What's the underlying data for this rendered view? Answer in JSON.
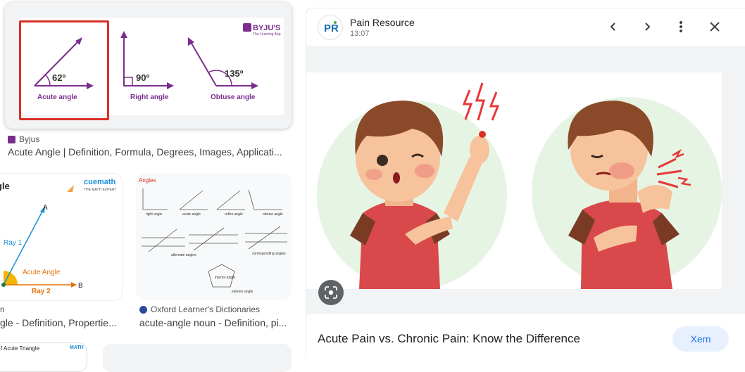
{
  "results": [
    {
      "source": "Byjus",
      "title": "Acute Angle | Definition, Formula, Degrees, Images, Applicati...",
      "image": {
        "brand": "BYJU'S",
        "brand_sub": "The Learning App",
        "angles": [
          {
            "value": "62º",
            "label": "Acute angle"
          },
          {
            "value": "90º",
            "label": "Right angle"
          },
          {
            "value": "135º",
            "label": "Obtuse angle"
          }
        ]
      }
    },
    {
      "source": "n",
      "title": "gle - Definition, Propertie...",
      "image": {
        "heading": "gle",
        "brand": "cuemath",
        "brand_sub": "THE MATH EXPERT",
        "point_a": "A",
        "point_b": "B",
        "ray1": "Ray 1",
        "ray2": "Ray 2",
        "angle_label": "Acute Angle"
      }
    },
    {
      "source": "Oxford Learner's Dictionaries",
      "title": "acute-angle noun - Definition, pi...",
      "image": {
        "heading": "Angles",
        "labels": [
          "right angle",
          "acute angle",
          "reflex angle",
          "obtuse angle",
          "alternate angles",
          "corresponding angles",
          "interior angle",
          "exterior angle"
        ]
      }
    },
    {
      "title_partial": "f Acute Triangle",
      "brand_partial": "MATH"
    }
  ],
  "preview": {
    "site_name": "Pain Resource",
    "logo_text": "PR",
    "time": "13:07",
    "caption": "Acute Pain vs. Chronic Pain: Know the Difference",
    "visit_label": "Xem",
    "icons": [
      "chevron-left-icon",
      "chevron-right-icon",
      "more-vert-icon",
      "close-icon",
      "lens-icon"
    ]
  },
  "colors": {
    "selection_border": "#d93025",
    "byjus_purple": "#7b2d8e",
    "cuemath_blue": "#1a8fd8",
    "visit_button_bg": "#e8f0fe",
    "visit_button_text": "#1a73e8"
  }
}
